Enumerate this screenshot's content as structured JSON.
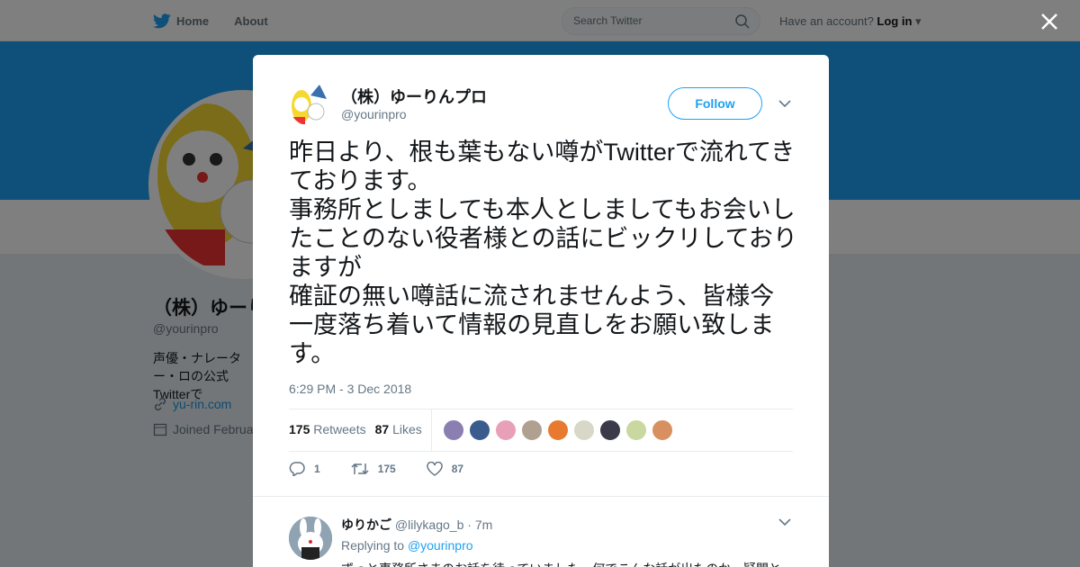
{
  "nav": {
    "home": "Home",
    "about": "About"
  },
  "search": {
    "placeholder": "Search Twitter"
  },
  "account": {
    "prompt": "Have an account?",
    "login": "Log in"
  },
  "profile": {
    "name": "（株）ゆーりんプロ",
    "handle": "@yourinpro",
    "bio": "声優・ナレーター・ロの公式Twitterで",
    "url": "yu-rin.com",
    "joined": "Joined Februa"
  },
  "tweet": {
    "name": "（株）ゆーりんプロ",
    "handle": "@yourinpro",
    "follow": "Follow",
    "text": "昨日より、根も葉もない噂がTwitterで流れてきております。\n事務所としましても本人としましてもお会いしたことのない役者様との話にビックリしておりますが\n確証の無い噂話に流されませんよう、皆様今一度落ち着いて情報の見直しをお願い致します。",
    "time": "6:29 PM - 3 Dec 2018",
    "retweets_count": "175",
    "retweets_label": "Retweets",
    "likes_count": "87",
    "likes_label": "Likes",
    "reply_count": "1",
    "retweet_count": "175",
    "like_count": "87"
  },
  "likers": [
    "#8a7fb0",
    "#3b5b8c",
    "#e8a0b8",
    "#b0a090",
    "#e87a30",
    "#d8d8c8",
    "#3a3a4a",
    "#c8d8a0",
    "#d89060"
  ],
  "reply": {
    "name": "ゆりかご",
    "handle": "@lilykago_b",
    "time": "7m",
    "replying_prefix": "Replying to",
    "replying_to": "@yourinpro",
    "text": "ずっと事務所さまのお話を待っていました。何でこんな話が出たのか、疑問と"
  },
  "colors": {
    "brand": "#1da1f2",
    "muted": "#657786",
    "link": "#1b95e0"
  }
}
